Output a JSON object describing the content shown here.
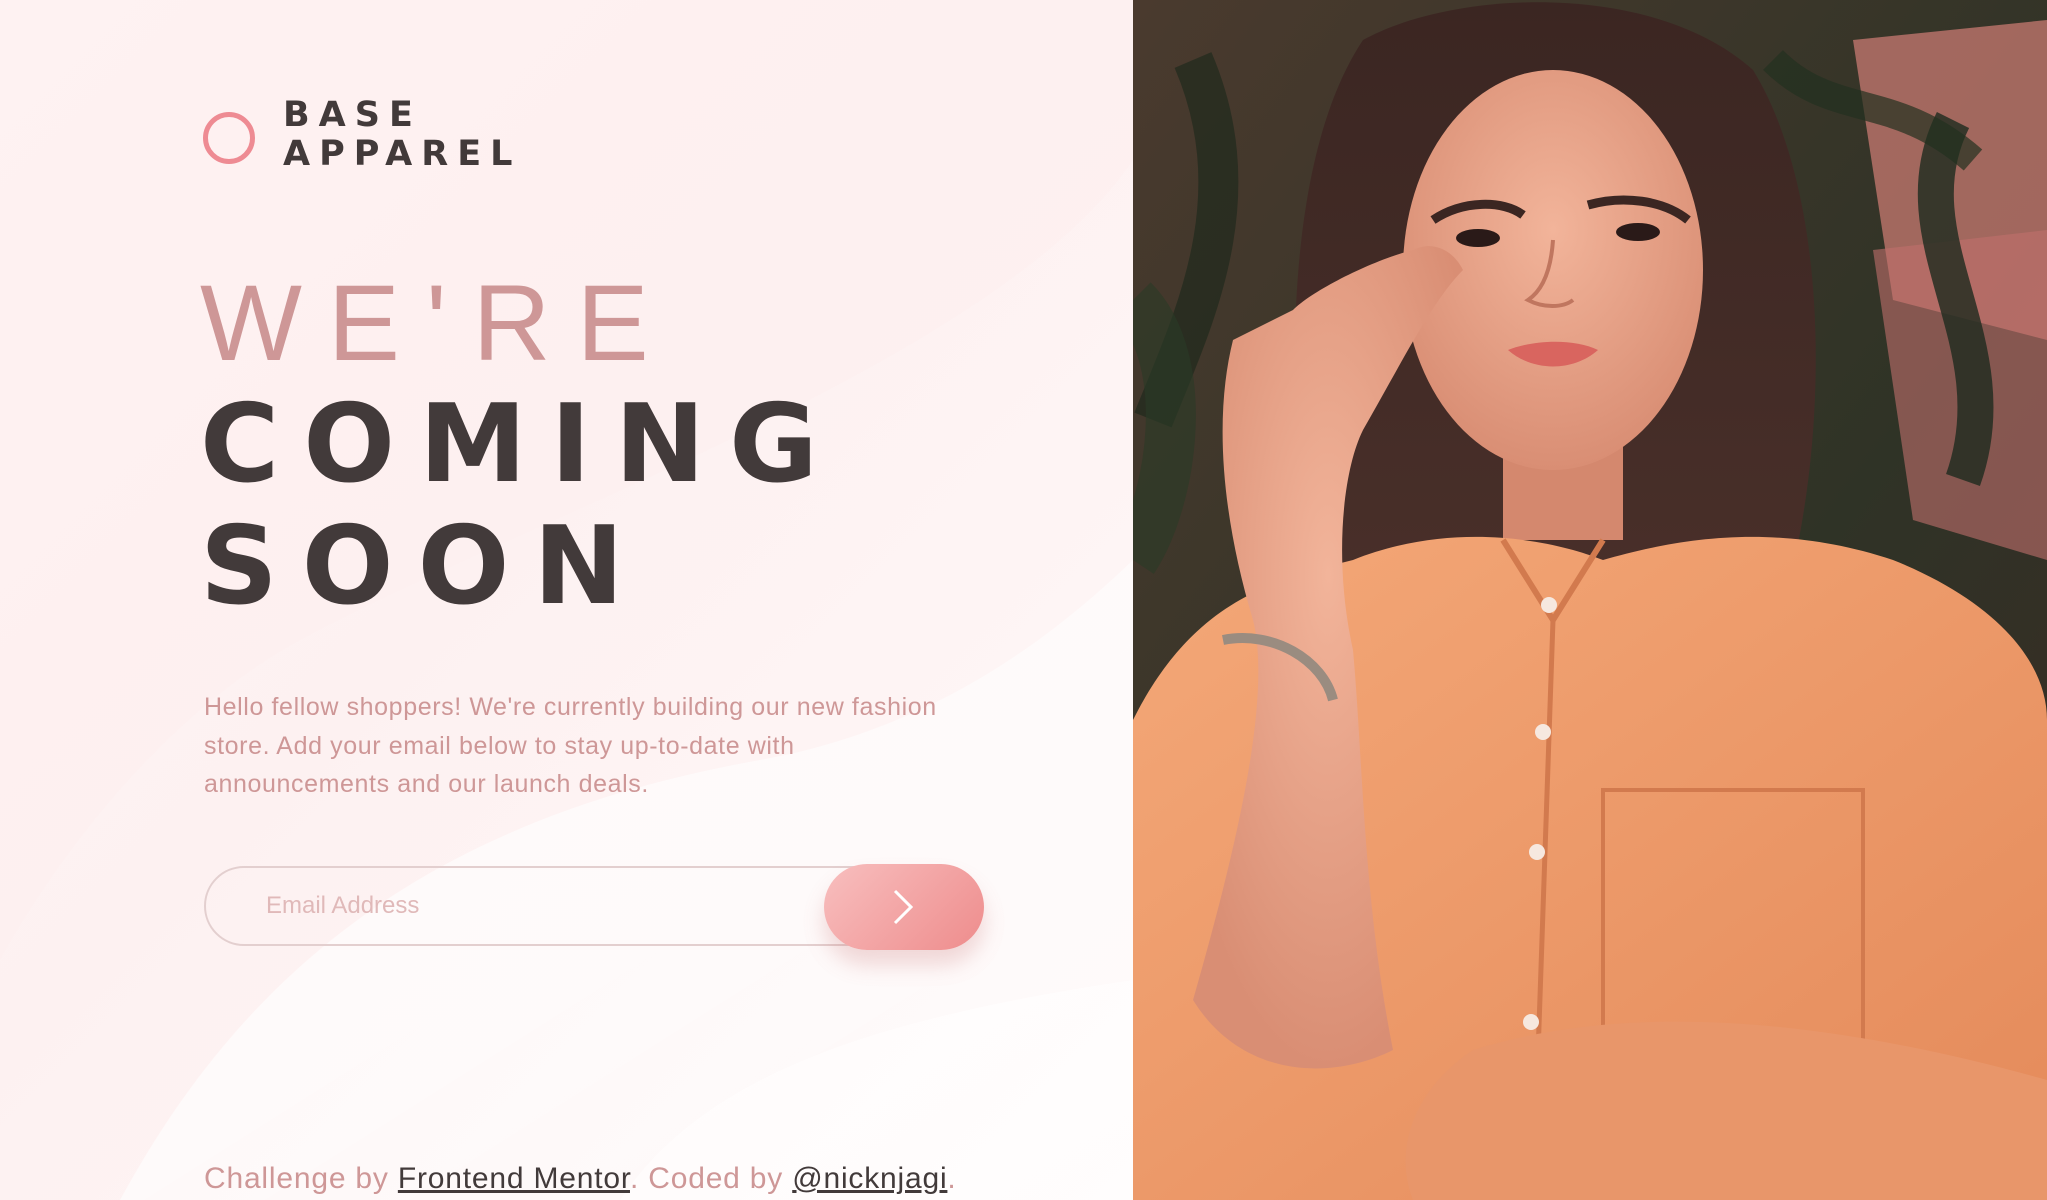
{
  "brand": {
    "line1": "BASE",
    "line2": "APPAREL"
  },
  "headline": {
    "light": "WE'RE",
    "bold_line1": "COMING",
    "bold_line2": "SOON"
  },
  "intro": "Hello fellow shoppers! We're currently building our new fashion store. Add your email below to stay up-to-date with announcements and our launch deals.",
  "form": {
    "email_placeholder": "Email Address",
    "email_value": "",
    "submit_icon": "chevron-right-icon"
  },
  "footer": {
    "prefix": "Challenge by ",
    "link1": "Frontend Mentor",
    "middle": ". Coded by ",
    "link2": "@nicknjagi",
    "suffix": "."
  },
  "colors": {
    "accent": "#ee8c8c",
    "text_pink": "#ce9797",
    "text_dark": "#423a3a",
    "background": "#fff5f5"
  },
  "hero_image": "woman-in-orange-shirt-photo"
}
